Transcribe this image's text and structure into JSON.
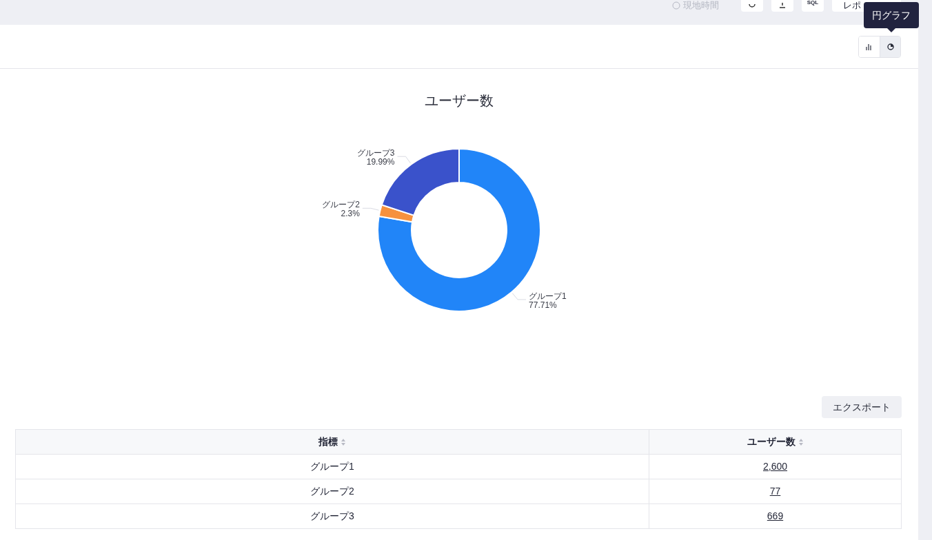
{
  "top_bar": {
    "local_time": "現地時間",
    "sql_button": "SQL",
    "save_button": "レポ"
  },
  "chart_toggle": [
    {
      "kind": "bar",
      "selected": false
    },
    {
      "kind": "pie",
      "selected": true
    }
  ],
  "tooltip": "円グラフ",
  "chart": {
    "chart_data": {
      "type": "donut",
      "title": "ユーザー数",
      "categories": [
        "グループ1",
        "グループ2",
        "グループ3"
      ],
      "series": [
        {
          "colors": [
            "#2185f8",
            "#f6913e",
            "#3a52cb"
          ],
          "values": [
            77.71,
            2.3,
            19.99
          ]
        }
      ],
      "value_labels": [
        "77.71%",
        "2.3%",
        "19.99%"
      ]
    }
  },
  "export_button": "エクスポート",
  "table": {
    "columns": [
      "指標",
      "ユーザー数"
    ],
    "rows": [
      [
        "グループ1",
        "2,600"
      ],
      [
        "グループ2",
        "77"
      ],
      [
        "グループ3",
        "669"
      ]
    ]
  }
}
